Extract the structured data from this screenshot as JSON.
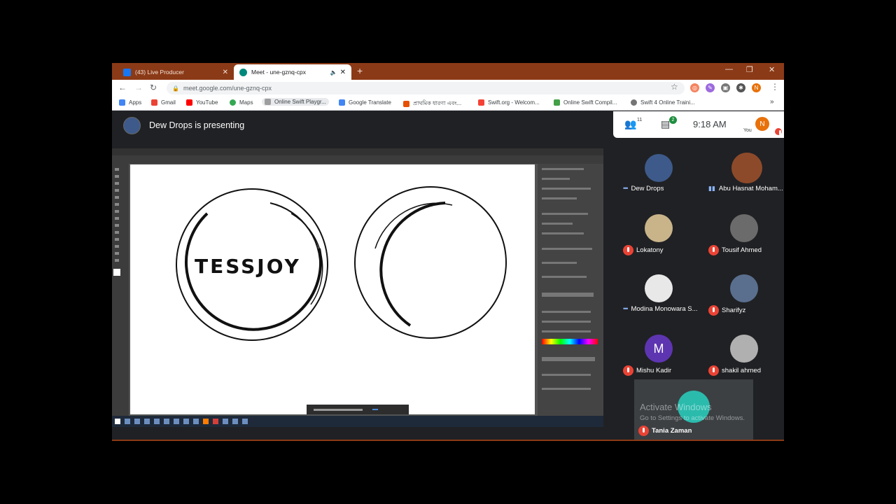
{
  "browser": {
    "tabs": [
      {
        "label": "(43) Live Producer",
        "favicon_color": "#1877f2"
      },
      {
        "label": "Meet - une-gznq-cpx",
        "favicon_color": "#00897b"
      }
    ],
    "url": "meet.google.com/une-gznq-cpx",
    "bookmarks": [
      {
        "label": "Apps",
        "color": "#4285f4"
      },
      {
        "label": "Gmail",
        "color": "#ea4335"
      },
      {
        "label": "YouTube",
        "color": "#ff0000"
      },
      {
        "label": "Maps",
        "color": "#34a853"
      },
      {
        "label": "Online Swift Playgr...",
        "color": "#9e9e9e"
      },
      {
        "label": "Google Translate",
        "color": "#4285f4"
      },
      {
        "label": "প্রাথমিক ধারণা এবং...",
        "color": "#e65100"
      },
      {
        "label": "Swift.org - Welcom...",
        "color": "#f44336"
      },
      {
        "label": "Online Swift Compil...",
        "color": "#43a047"
      },
      {
        "label": "Swift 4 Online Traini...",
        "color": "#757575"
      }
    ],
    "more": "»",
    "profile_initial": "N"
  },
  "meet": {
    "presenting_text": "Dew Drops is presenting",
    "participants_count": "11",
    "chat_count": "2",
    "time": "9:18 AM",
    "you_label": "You",
    "participants": [
      {
        "name": "Dew Drops",
        "status": "speaking-dots",
        "avatar_color": "#3d5a8a",
        "initial": ""
      },
      {
        "name": "Abu Hasnat Moham...",
        "status": "speaking-bars",
        "avatar_color": "#8d4a2a",
        "initial": ""
      },
      {
        "name": "Lokatony",
        "status": "muted",
        "avatar_color": "#c9b48a",
        "initial": ""
      },
      {
        "name": "Tousif Ahmed",
        "status": "muted",
        "avatar_color": "#6b6b6b",
        "initial": ""
      },
      {
        "name": "Modina Monowara S...",
        "status": "speaking-dots",
        "avatar_color": "#e8e8e8",
        "initial": ""
      },
      {
        "name": "Sharifyz",
        "status": "muted",
        "avatar_color": "#5a6f8e",
        "initial": ""
      },
      {
        "name": "Mishu Kadir",
        "status": "muted",
        "avatar_color": "#5e35b1",
        "initial": "M"
      },
      {
        "name": "shakil ahmed",
        "status": "muted",
        "avatar_color": "#b0b0b0",
        "initial": ""
      }
    ],
    "self_tile_name": "Tania Zaman"
  },
  "shared_screen": {
    "logo_text": "TESSJOY"
  },
  "windows_watermark": {
    "line1": "Activate Windows",
    "line2": "Go to Settings to activate Windows."
  }
}
